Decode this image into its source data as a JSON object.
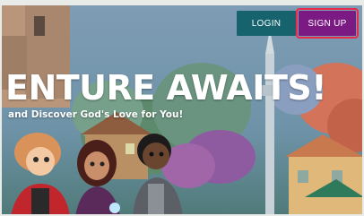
{
  "header": {
    "login_label": "LOGIN",
    "signup_label": "SIGN UP"
  },
  "hero": {
    "headline": "ENTURE AWAITS!",
    "subheadline": "and Discover God's Love for You!"
  },
  "colors": {
    "login_bg": "#16636e",
    "signup_bg": "#7c1a83",
    "signup_outline": "#ea2a4a"
  }
}
